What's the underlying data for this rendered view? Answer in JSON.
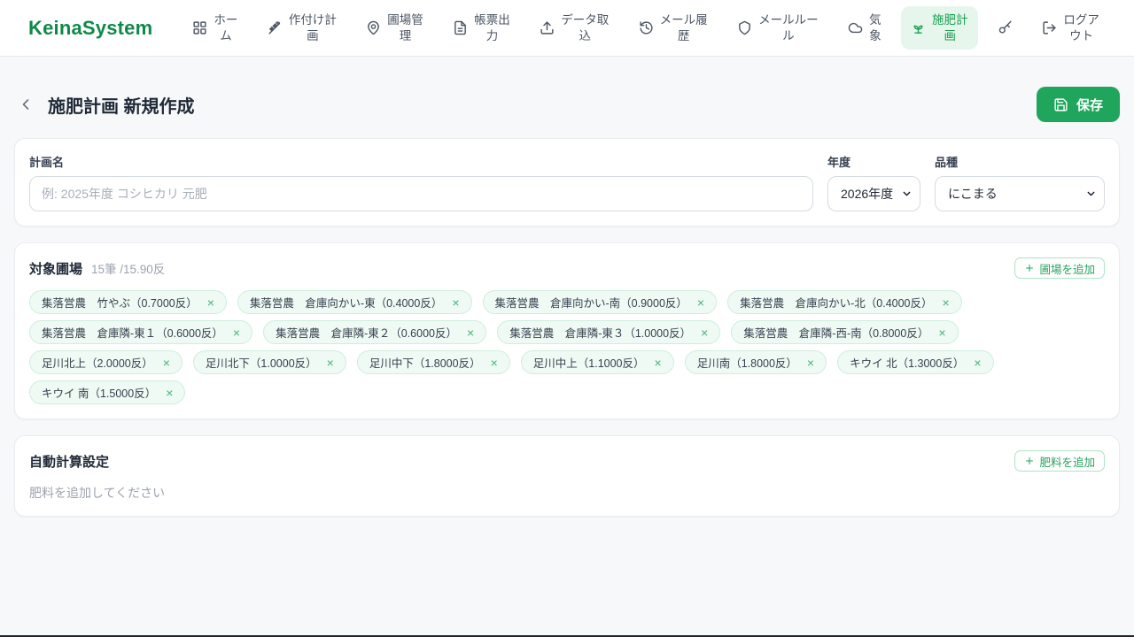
{
  "brand": "KeinaSystem",
  "nav": {
    "items": [
      {
        "id": "home",
        "icon": "grid-icon",
        "label": "ホー\nム"
      },
      {
        "id": "cropping-plan",
        "icon": "wheat-icon",
        "label": "作付け計\n画"
      },
      {
        "id": "field-management",
        "icon": "map-pin-icon",
        "label": "圃場管\n理"
      },
      {
        "id": "report-output",
        "icon": "document-icon",
        "label": "帳票出\n力"
      },
      {
        "id": "data-import",
        "icon": "upload-icon",
        "label": "データ取\n込"
      },
      {
        "id": "mail-history",
        "icon": "history-icon",
        "label": "メール履\n歴"
      },
      {
        "id": "mail-rules",
        "icon": "shield-icon",
        "label": "メールルー\nル"
      },
      {
        "id": "weather",
        "icon": "cloud-icon",
        "label": "気\n象"
      },
      {
        "id": "fertilization-plan",
        "icon": "sprout-icon",
        "label": "施肥計\n画",
        "active": true
      },
      {
        "id": "key",
        "icon": "key-icon",
        "label": ""
      },
      {
        "id": "logout",
        "icon": "logout-icon",
        "label": "ログア\nウト"
      }
    ]
  },
  "header": {
    "title": "施肥計画 新規作成",
    "save_label": "保存"
  },
  "plan_form": {
    "name_label": "計画名",
    "name_placeholder": "例: 2025年度 コシヒカリ 元肥",
    "year_label": "年度",
    "year_value": "2026年度",
    "variety_label": "品種",
    "variety_value": "にこまる"
  },
  "fields_section": {
    "title": "対象圃場",
    "count_summary": "15筆 /15.90反",
    "add_button_label": "圃場を追加",
    "tags": [
      "集落営農　竹やぶ（0.7000反）",
      "集落営農　倉庫向かい-東（0.4000反）",
      "集落営農　倉庫向かい-南（0.9000反）",
      "集落営農　倉庫向かい-北（0.4000反）",
      "集落営農　倉庫隣-東１（0.6000反）",
      "集落営農　倉庫隣-東２（0.6000反）",
      "集落営農　倉庫隣-東３（1.0000反）",
      "集落営農　倉庫隣-西-南（0.8000反）",
      "足川北上（2.0000反）",
      "足川北下（1.0000反）",
      "足川中下（1.8000反）",
      "足川中上（1.1000反）",
      "足川南（1.8000反）",
      "キウイ 北（1.3000反）",
      "キウイ 南（1.5000反）"
    ]
  },
  "auto_calc_section": {
    "title": "自動計算設定",
    "add_button_label": "肥料を追加",
    "empty_message": "肥料を追加してください"
  },
  "colors": {
    "accent_green": "#1fa65c",
    "active_nav_bg": "#e7f6ec",
    "tag_bg": "#eefaf3",
    "page_bg": "#f7f8fa"
  }
}
